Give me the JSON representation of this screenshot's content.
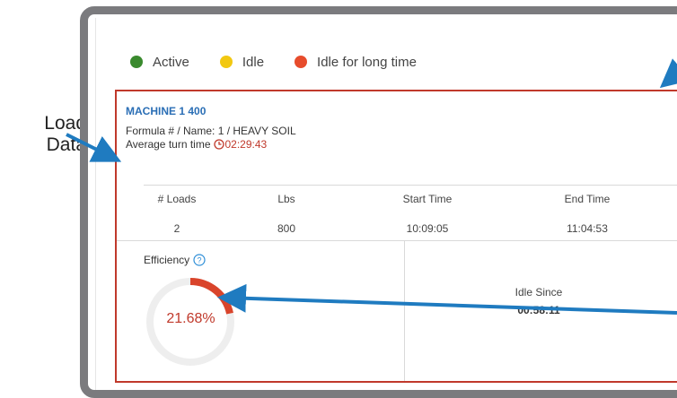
{
  "callouts": {
    "load_data": "Load\nData"
  },
  "legend": [
    {
      "label": "Active",
      "color": "#3a8a2e"
    },
    {
      "label": "Idle",
      "color": "#f2c811"
    },
    {
      "label": "Idle for long time",
      "color": "#e74c2c"
    }
  ],
  "machine": {
    "title": "MACHINE 1 400",
    "formula_line": "Formula # / Name: 1 / HEAVY SOIL",
    "turn_time_label": "Average turn time",
    "turn_time_value": "02:29:43",
    "clock_icon": "clock-icon"
  },
  "table": {
    "headers": [
      "# Loads",
      "Lbs",
      "Start Time",
      "End Time"
    ],
    "row": [
      "2",
      "800",
      "10:09:05",
      "11:04:53"
    ]
  },
  "efficiency": {
    "label": "Efficiency",
    "help_icon": "question-circle-icon",
    "value": "21.68%",
    "fraction": 0.2168,
    "track_color": "#eeeeee",
    "fill_color": "#d9442b"
  },
  "idle": {
    "label": "Idle Since",
    "value": "00:58:11"
  },
  "colors": {
    "card_border": "#c0392b",
    "frame": "#7b7b7e",
    "arrow": "#1f7bc0",
    "title": "#2a6eb5"
  }
}
